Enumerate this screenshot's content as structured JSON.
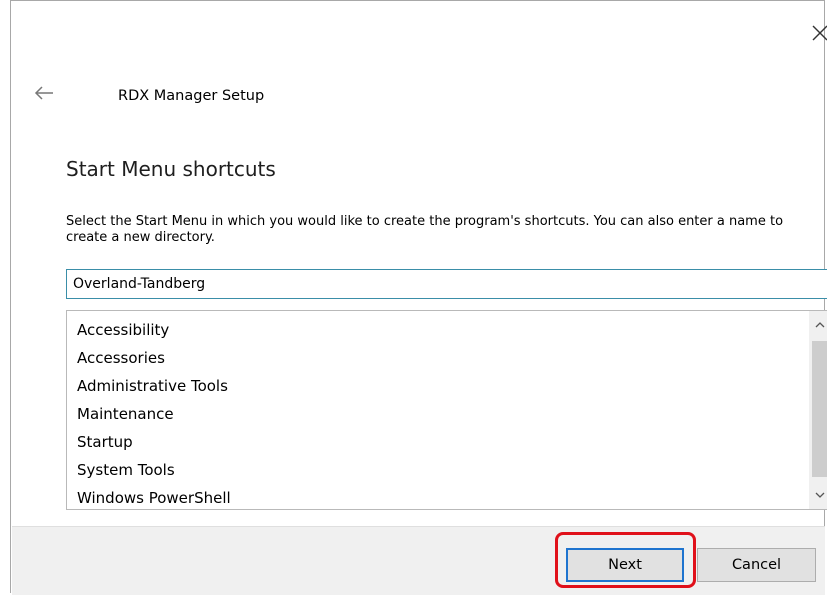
{
  "window": {
    "app_title": "RDX Manager Setup",
    "close_icon": "close-icon",
    "back_icon": "back-arrow-icon"
  },
  "page": {
    "heading": "Start Menu shortcuts",
    "description": "Select the Start Menu in which you would like to create the program's shortcuts. You can also enter a name to create a new directory."
  },
  "folder_input": {
    "value": "Overland-Tandberg"
  },
  "folder_list": {
    "items": [
      "Accessibility",
      "Accessories",
      "Administrative Tools",
      "Maintenance",
      "Startup",
      "System Tools",
      "Windows PowerShell"
    ]
  },
  "buttons": {
    "next_label": "Next",
    "cancel_label": "Cancel"
  },
  "colors": {
    "accent": "#1f74cf",
    "input_border": "#3a8ea8",
    "highlight": "#e0101a",
    "footer_bg": "#f0f0f0"
  }
}
